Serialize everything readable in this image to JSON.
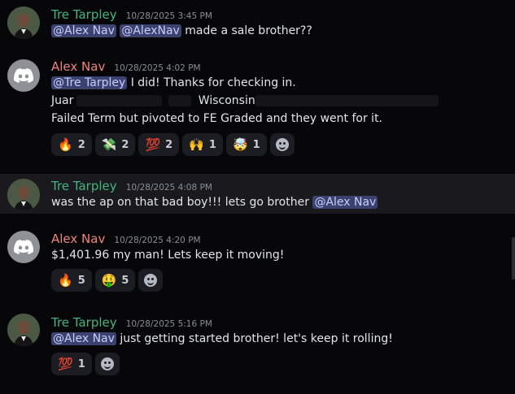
{
  "messages": [
    {
      "author": "Tre Tarpley",
      "timestamp": "10/28/2025 3:45 PM",
      "mentions": [
        "@Alex Nav",
        "@AlexNav"
      ],
      "text": "made a sale brother??"
    },
    {
      "author": "Alex Nav",
      "timestamp": "10/28/2025 4:02 PM",
      "mention": "@Tre Tarpley",
      "line1": "I did! Thanks for checking in.",
      "line2_a": "Juar",
      "line2_b": "Wisconsin",
      "line3": "Failed Term but pivoted to FE Graded and they went for it.",
      "reactions": [
        {
          "emoji": "🔥",
          "count": "2"
        },
        {
          "emoji": "💸",
          "count": "2"
        },
        {
          "emoji": "💯",
          "count": "2"
        },
        {
          "emoji": "🙌",
          "count": "1"
        },
        {
          "emoji": "🤯",
          "count": "1"
        }
      ]
    },
    {
      "author": "Tre Tarpley",
      "timestamp": "10/28/2025 4:08 PM",
      "text": "was the ap on that bad boy!!! lets go brother",
      "mention": "@Alex Nav"
    },
    {
      "author": "Alex Nav",
      "timestamp": "10/28/2025 4:20 PM",
      "text": "$1,401.96 my man! Lets keep it moving!",
      "reactions": [
        {
          "emoji": "🔥",
          "count": "5"
        },
        {
          "emoji": "🤑",
          "count": "5"
        }
      ]
    },
    {
      "author": "Tre Tarpley",
      "timestamp": "10/28/2025 5:16 PM",
      "mention": "@Alex Nav",
      "text": "just getting started brother! let's keep it rolling!",
      "reactions": [
        {
          "emoji": "💯",
          "count": "1"
        }
      ]
    }
  ],
  "colors": {
    "tre_name": "#43b581",
    "alex_name": "#f0837c",
    "mention_bg": "#3c4270",
    "background": "#070709"
  },
  "icons": {
    "tre_avatar": "profile-photo",
    "alex_avatar": "discord-logo",
    "add_reaction": "smiley-icon"
  }
}
